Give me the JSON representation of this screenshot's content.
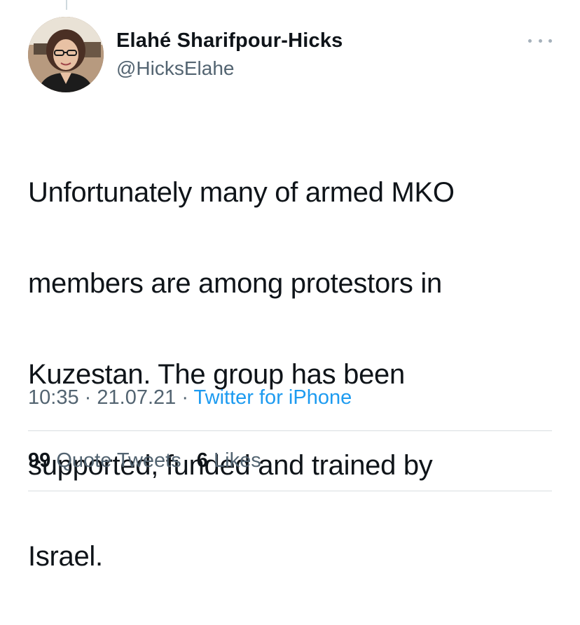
{
  "author": {
    "display_name": "Elahé Sharifpour-Hicks",
    "handle": "@HicksElahe"
  },
  "tweet": {
    "lines": [
      "Unfortunately many of armed MKO",
      "members are among protestors in",
      "Kuzestan. The group has been",
      "supported, funded and trained by",
      "Israel."
    ]
  },
  "meta": {
    "time": "10:35",
    "separator": "·",
    "date": "21.07.21",
    "source": "Twitter for iPhone"
  },
  "stats": {
    "quote_tweets_count": "99",
    "quote_tweets_label": "Quote Tweets",
    "likes_count": "6",
    "likes_label": "Likes"
  },
  "icons": {
    "more": "more-horizontal-icon"
  },
  "colors": {
    "text_primary": "#0f1419",
    "text_secondary": "#536471",
    "link": "#1d9bf0",
    "divider": "#d8dde1"
  }
}
